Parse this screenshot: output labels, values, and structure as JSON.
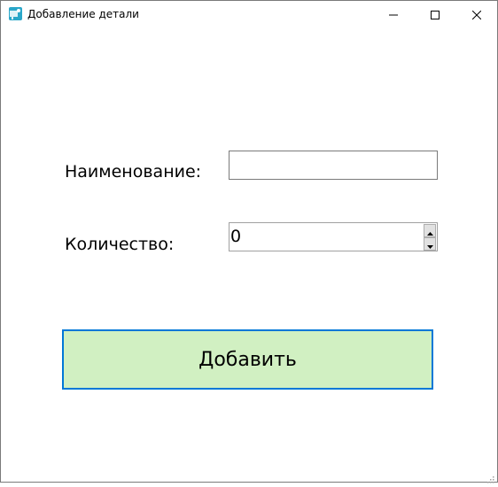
{
  "window": {
    "title": "Добавление детали",
    "app_icon": "app-icon",
    "controls": {
      "minimize_icon": "minimize-icon",
      "maximize_icon": "maximize-icon",
      "close_icon": "close-icon"
    }
  },
  "form": {
    "name_label": "Наименование:",
    "name_value": "",
    "quantity_label": "Количество:",
    "quantity_value": "0",
    "add_button_label": "Добавить"
  },
  "colors": {
    "button_background": "#d1f0c2",
    "button_border": "#0078d7"
  }
}
